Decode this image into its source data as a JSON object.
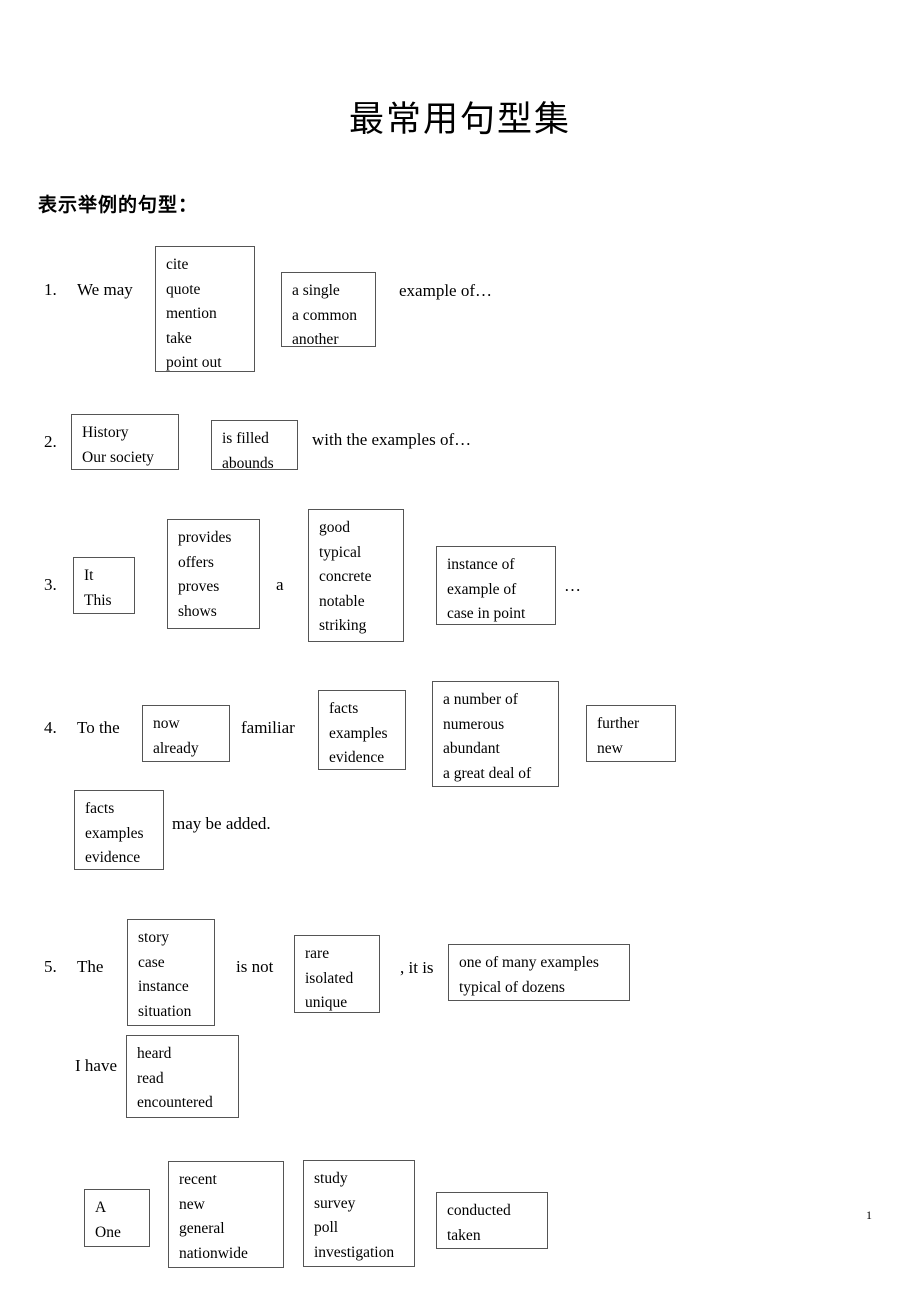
{
  "document": {
    "title": "最常用句型集",
    "section_heading": "表示举例的句型：",
    "page_number": "1"
  },
  "items": [
    {
      "number": "1.",
      "lead": "We may",
      "box1": [
        "cite",
        "quote",
        "mention",
        "take",
        "point out"
      ],
      "box2": [
        "a single",
        "a common",
        "another"
      ],
      "tail": "example of…"
    },
    {
      "number": "2.",
      "box1": [
        "History",
        "Our society"
      ],
      "box2": [
        "is filled",
        "abounds"
      ],
      "tail": "with the examples of…"
    },
    {
      "number": "3.",
      "box1": [
        "It",
        "This"
      ],
      "box2": [
        "provides",
        "offers",
        "proves",
        "shows"
      ],
      "article": "a",
      "box3": [
        "good",
        "typical",
        "concrete",
        "notable",
        "striking"
      ],
      "box4": [
        "instance of",
        "example of",
        "case in point"
      ],
      "ellipsis": "…"
    },
    {
      "number": "4.",
      "lead": "To the",
      "box1": [
        "now",
        "already"
      ],
      "mid": "familiar",
      "box2": [
        "facts",
        "examples",
        "evidence"
      ],
      "box3": [
        "a number of",
        "numerous",
        "abundant",
        "a great deal of"
      ],
      "box4": [
        "further",
        "new"
      ],
      "box5": [
        "facts",
        "examples",
        "evidence"
      ],
      "tail": "may be added."
    },
    {
      "number": "5.",
      "lead": "The",
      "box1": [
        "story",
        "case",
        "instance",
        "situation"
      ],
      "mid": "is not",
      "box2": [
        "rare",
        "isolated",
        "unique"
      ],
      "mid2": ", it is",
      "box3": [
        "one of many examples",
        "typical of dozens"
      ],
      "lead2": "I have",
      "box4": [
        "heard",
        "read",
        "encountered"
      ]
    },
    {
      "number": "",
      "box1": [
        "A",
        "One"
      ],
      "box2": [
        "recent",
        "new",
        "general",
        "nationwide"
      ],
      "box3": [
        "study",
        "survey",
        "poll",
        "investigation"
      ],
      "box4": [
        "conducted",
        "taken"
      ]
    }
  ]
}
